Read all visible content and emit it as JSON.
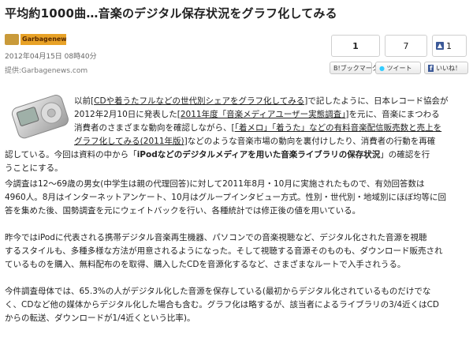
{
  "article": {
    "title": "平均約1000曲…音楽のデジタル保存状況をグラフ化してみる",
    "logo_text": "Garbagenews.com",
    "date": "2012年04月15日 08時40分",
    "source_label": "提供:",
    "source_name": "Garbagenews.com"
  },
  "social": {
    "count1": "1",
    "count2": "7",
    "like_count": "1",
    "hatena_label": "B!ブックマーク",
    "tweet_label": "ツイート",
    "iine_label": "いいね！"
  },
  "body": {
    "p1": {
      "l1_a": "以前[",
      "l1_link": "CDや着うたフルなどの世代別シェアをグラフ化してみる",
      "l1_b": "]で記したように、日本レコード協会が",
      "l2_a": "2012年2月10日に発表した[",
      "l2_link": "2011年度「音楽メディアユーザー実態調査」",
      "l2_b": "]を元に、音楽にまつわる",
      "l3_a": "消費者のさまざまな動向を確認しながら、[",
      "l3_link": "「着メロ」「着うた」などの有料音楽配信販売数と売上を",
      "l4_link": "グラフ化してみる(2011年版)",
      "l4_b": "]などのような音楽市場の動向を裏付けしたり、消費者の行動を再確",
      "l5_a": "認している。今回は資料の中から「",
      "l5_bold": "iPodなどのデジタルメディアを用いた音楽ライブラリの保存状況",
      "l5_b": "」の確認を行",
      "l6": "うことにする。"
    },
    "p2": {
      "l1": "今調査は12～69歳の男女(中学生は親の代理回答)に対して2011年8月・10月に実施されたもので、有効回答数は",
      "l2": "4960人。8月はインターネットアンケート、10月はグループインタビュー方式。性別・世代別・地域別にほぼ均等に回",
      "l3": "答を集めた後、国勢調査を元にウェイトバックを行い、各種統計では修正後の値を用いている。"
    },
    "p3": {
      "l1": "昨今ではiPodに代表される携帯デジタル音楽再生機器、パソコンでの音楽視聴など、デジタル化された音源を視聴",
      "l2": "するスタイルも、多種多様な方法が用意されるようになった。そして視聴する音源そのものも、ダウンロード販売され",
      "l3": "ているものを購入、無料配布のを取得、購入したCDを音源化するなど、さまざまなルートで入手されうる。"
    },
    "p4": {
      "l1": "今件調査母体では、65.3%の人がデジタル化した音源を保存している(最初からデジタル化されているものだけでな",
      "l2": "く、CDなど他の媒体からデジタル化した場合も含む。グラフ化は略するが、該当者によるライブラリの3/4近くはCD",
      "l3": "からの転送、ダウンロードが1/4近くという比率)。"
    }
  }
}
